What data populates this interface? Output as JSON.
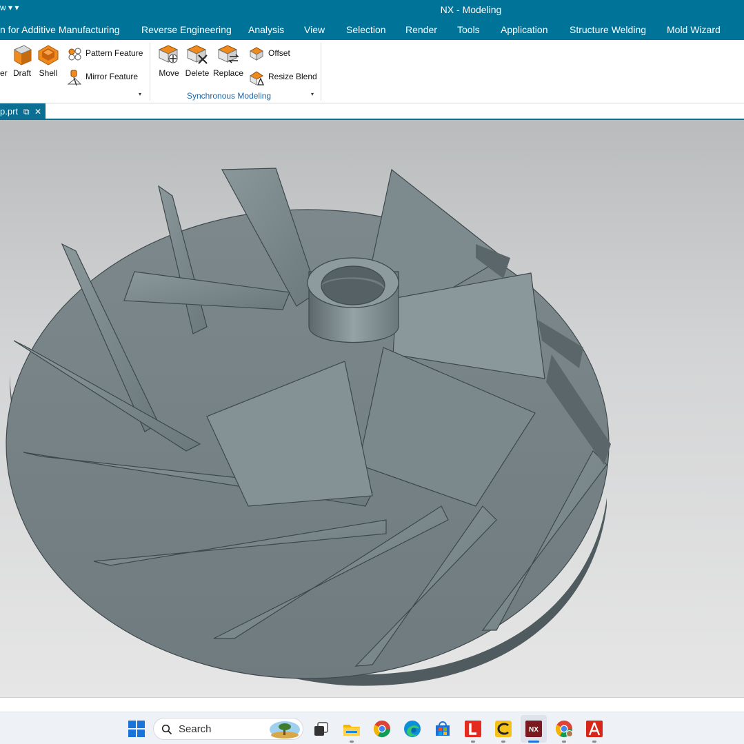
{
  "window": {
    "title": "NX - Modeling",
    "quick_access": "w ▾ ▾"
  },
  "ribbon_tabs": [
    "n for Additive Manufacturing",
    "Reverse Engineering",
    "Analysis",
    "View",
    "Selection",
    "Render",
    "Tools",
    "Application",
    "Structure Welding",
    "Mold Wizard"
  ],
  "feature_group": {
    "cut_label": "er",
    "draft": "Draft",
    "shell": "Shell",
    "pattern_feature": "Pattern Feature",
    "mirror_feature": "Mirror Feature"
  },
  "sync_group": {
    "title": "Synchronous Modeling",
    "move": "Move",
    "delete": "Delete",
    "replace": "Replace",
    "offset": "Offset",
    "resize_blend": "Resize Blend"
  },
  "document_tab": {
    "name": "p.prt",
    "undock_glyph": "⧉",
    "close_glyph": "✕"
  },
  "taskbar": {
    "search_placeholder": "Search",
    "apps": [
      "start",
      "search",
      "task-view",
      "file-explorer",
      "chrome",
      "edge",
      "microsoft-store",
      "l-app",
      "c-app",
      "nx",
      "chrome-profile",
      "acrobat"
    ]
  },
  "colors": {
    "titlebar": "#007399",
    "accent_orange": "#f08a1c",
    "model_gray": "#7a878b"
  }
}
